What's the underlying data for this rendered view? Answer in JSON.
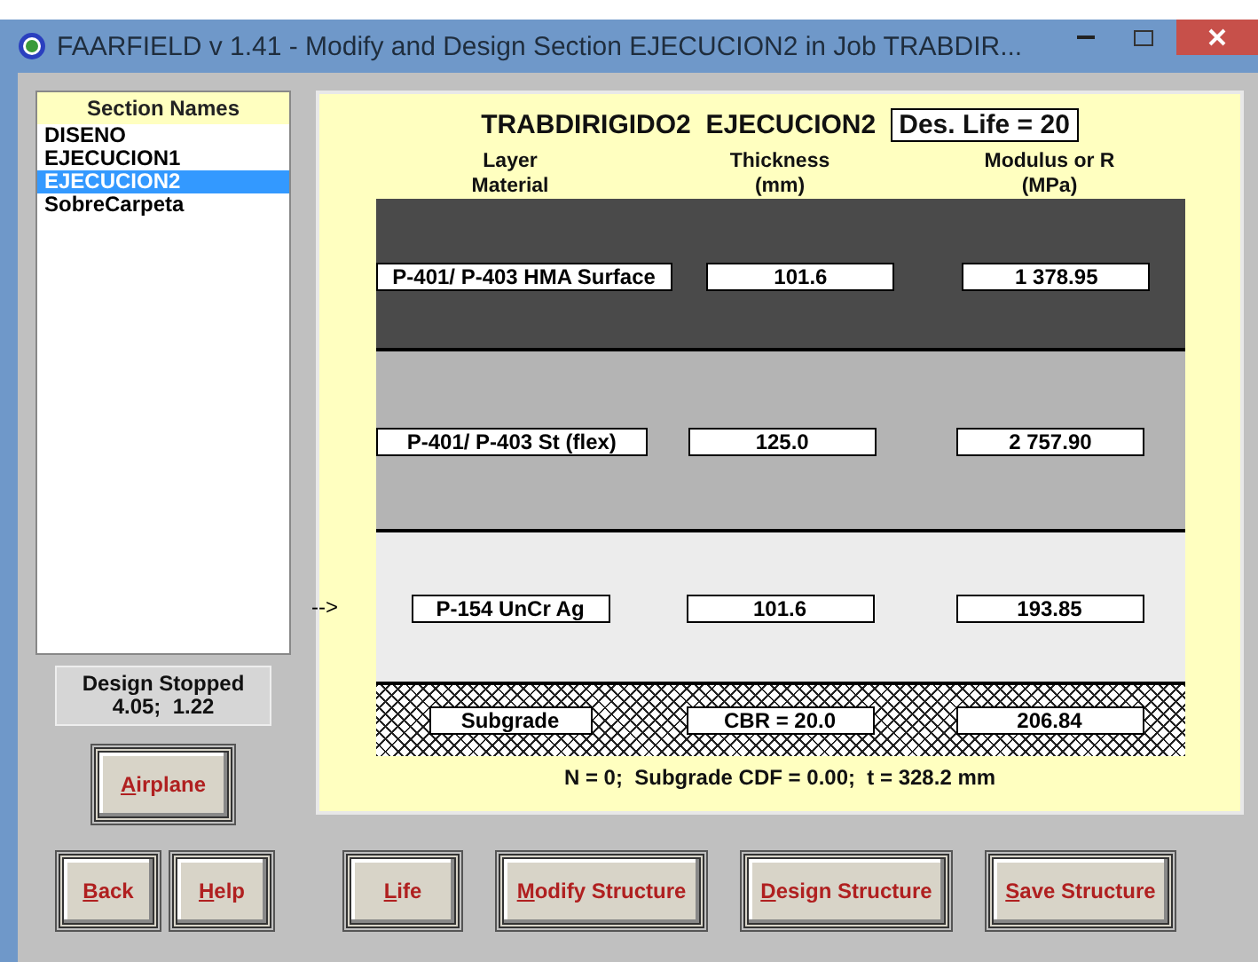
{
  "window": {
    "title": "FAARFIELD v 1.41 - Modify and Design Section EJECUCION2 in Job TRABDIR..."
  },
  "sections": {
    "header": "Section Names",
    "items": [
      {
        "label": "DISENO",
        "selected": false
      },
      {
        "label": "EJECUCION1",
        "selected": false
      },
      {
        "label": "EJECUCION2",
        "selected": true
      },
      {
        "label": "SobreCarpeta",
        "selected": false
      }
    ]
  },
  "status": {
    "lines": [
      "Design Stopped",
      "4.05;  1.22"
    ]
  },
  "structure": {
    "job": "TRABDIRIGIDO2",
    "section": "EJECUCION2",
    "design_life": "Des. Life = 20",
    "columns": [
      [
        "Layer",
        "Material"
      ],
      [
        "Thickness",
        "(mm)"
      ],
      [
        "Modulus or R",
        "(MPa)"
      ]
    ],
    "layers": [
      {
        "kind": "layer",
        "color": "#4a4a4a",
        "material": "P-401/ P-403 HMA Surface",
        "thickness": "101.6",
        "modulus": "1 378.95"
      },
      {
        "kind": "layer",
        "color": "#b4b4b4",
        "material": "P-401/ P-403 St (flex)",
        "thickness": "125.0",
        "modulus": "2 757.90"
      },
      {
        "kind": "layer",
        "color": "#ececec",
        "material": "P-154 UnCr Ag",
        "thickness": "101.6",
        "modulus": "193.85",
        "pointer": "-->"
      },
      {
        "kind": "subgrade",
        "material": "Subgrade",
        "thickness": "CBR = 20.0",
        "modulus": "206.84"
      }
    ],
    "summary": "N = 0;  Subgrade CDF = 0.00;  t = 328.2 mm"
  },
  "buttons": {
    "side": [
      "Airplane"
    ],
    "bottom_left": [
      "Back",
      "Help"
    ],
    "bottom_right": [
      "Life",
      "Modify Structure",
      "Design Structure",
      "Save Structure"
    ]
  }
}
